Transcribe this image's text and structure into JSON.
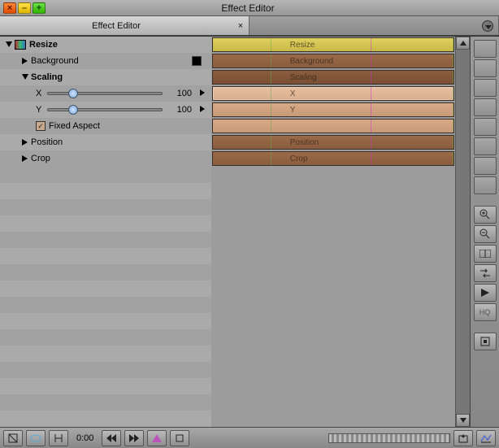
{
  "window": {
    "title": "Effect Editor"
  },
  "tab": {
    "label": "Effect Editor",
    "close": "×"
  },
  "tree": {
    "resize": "Resize",
    "background": "Background",
    "scaling": "Scaling",
    "x": "X",
    "y": "Y",
    "xval": "100",
    "yval": "100",
    "fixed": "Fixed Aspect",
    "position": "Position",
    "crop": "Crop"
  },
  "tracks": {
    "labels": [
      "Resize",
      "Background",
      "Scaling",
      "X",
      "Y",
      "",
      "Position",
      "Crop"
    ]
  },
  "status": {
    "time": "0:00"
  },
  "side": {
    "hq": "HQ"
  }
}
